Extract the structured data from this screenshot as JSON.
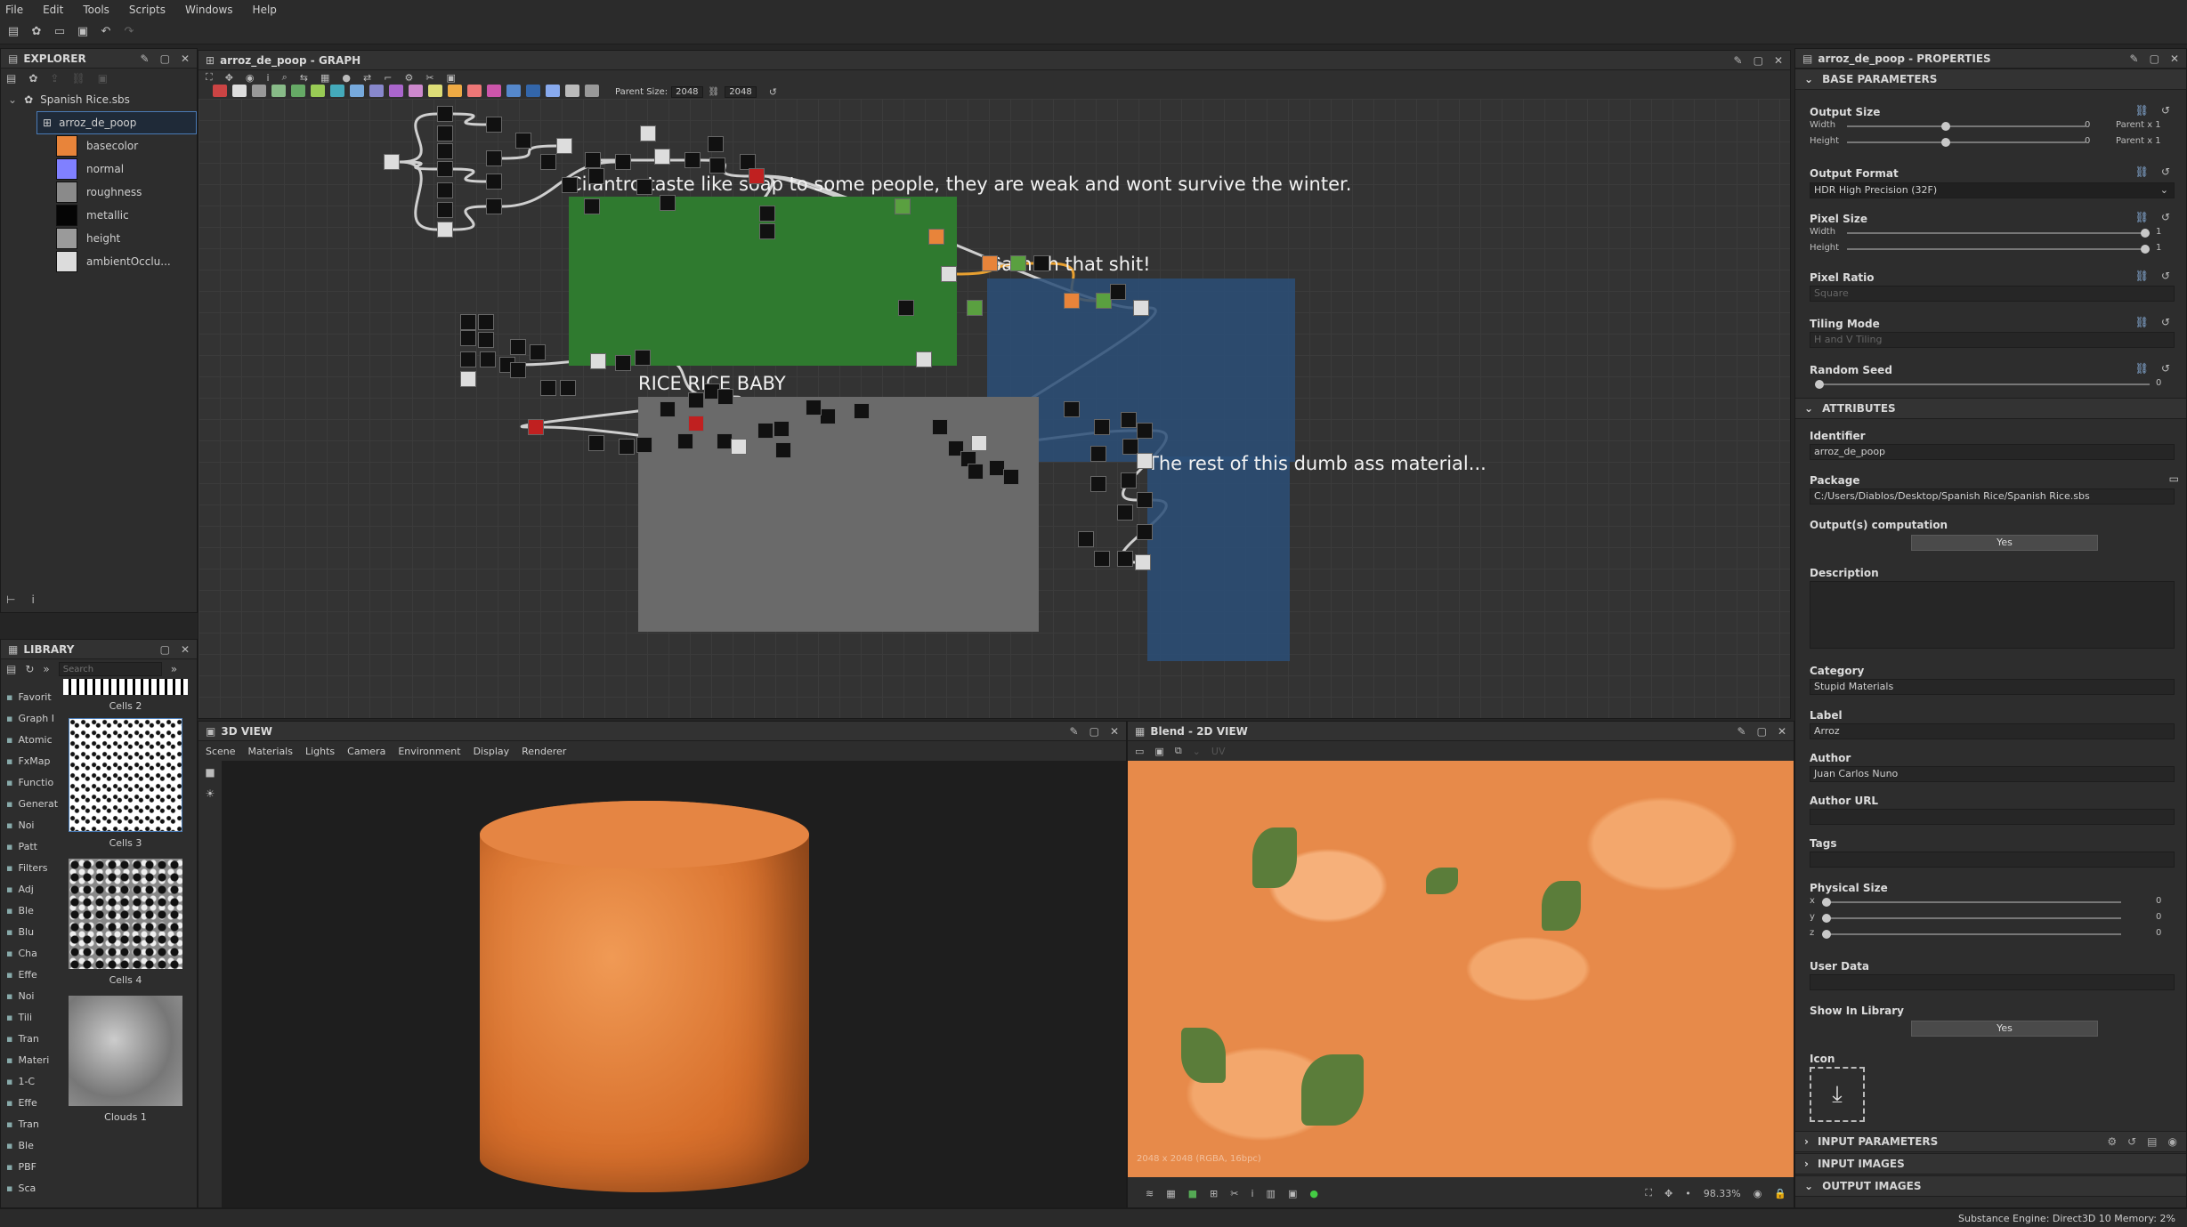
{
  "menu": [
    "File",
    "Edit",
    "Tools",
    "Scripts",
    "Windows",
    "Help"
  ],
  "explorer": {
    "title": "EXPLORER",
    "package": "Spanish Rice.sbs",
    "graph": "arroz_de_poop",
    "outputs": [
      {
        "label": "basecolor",
        "color": "#e8843a"
      },
      {
        "label": "normal",
        "color": "#8080ff"
      },
      {
        "label": "roughness",
        "color": "#8a8a8a"
      },
      {
        "label": "metallic",
        "color": "#050505"
      },
      {
        "label": "height",
        "color": "#9a9a9a"
      },
      {
        "label": "ambientOcclu...",
        "color": "#dcdcdc"
      }
    ]
  },
  "library": {
    "title": "LIBRARY",
    "search_placeholder": "Search",
    "categories": [
      "Favorit",
      "Graph I",
      "Atomic",
      "FxMap",
      "Functio",
      "Generat",
      "Noi",
      "Patt",
      "Filters",
      "Adj",
      "Ble",
      "Blu",
      "Cha",
      "Effe",
      "Noi",
      "Tili",
      "Tran",
      "Materi",
      "1-C",
      "Effe",
      "Tran",
      "Ble",
      "PBF",
      "Sca"
    ],
    "thumbs": [
      "Cells 2",
      "Cells 3",
      "Cells 4",
      "Clouds 1"
    ]
  },
  "graph": {
    "title": "arroz_de_poop - GRAPH",
    "parent_size_label": "Parent Size:",
    "parent_size": "2048",
    "size": "2048",
    "frames": [
      {
        "title": "Cilantro taste like soap to some people, they are weak and wont survive the winter.",
        "color": "#2f7a2f"
      },
      {
        "title": "Garnish that shit!",
        "color": "#2c4f78"
      },
      {
        "title": "RICE RICE BABY",
        "color": "#6a6a6a"
      },
      {
        "title": "The rest of this dumb ass material...",
        "color": "#2c4f78"
      }
    ]
  },
  "view3d": {
    "title": "3D VIEW",
    "menu": [
      "Scene",
      "Materials",
      "Lights",
      "Camera",
      "Environment",
      "Display",
      "Renderer"
    ]
  },
  "view2d": {
    "title": "Blend - 2D VIEW",
    "uv": "UV",
    "info": "2048 x 2048 (RGBA, 16bpc)",
    "zoom": "98.33%"
  },
  "props": {
    "title": "arroz_de_poop - PROPERTIES",
    "base": "BASE PARAMETERS",
    "attributes": "ATTRIBUTES",
    "output_size": "Output Size",
    "width": "Width",
    "height": "Height",
    "zero": "0",
    "parent_x1": "Parent x 1",
    "one": "1",
    "output_format": "Output Format",
    "format_value": "HDR High Precision (32F)",
    "pixel_size": "Pixel Size",
    "pixel_ratio": "Pixel Ratio",
    "pixel_ratio_value": "Square",
    "tiling_mode": "Tiling Mode",
    "tiling_value": "H and V Tiling",
    "random_seed": "Random Seed",
    "identifier": "Identifier",
    "identifier_value": "arroz_de_poop",
    "package": "Package",
    "package_value": "C:/Users/Diablos/Desktop/Spanish Rice/Spanish Rice.sbs",
    "outputs_comp": "Output(s) computation",
    "yes": "Yes",
    "description": "Description",
    "category": "Category",
    "category_value": "Stupid Materials",
    "label": "Label",
    "label_value": "Arroz",
    "author": "Author",
    "author_value": "Juan Carlos Nuno",
    "author_url": "Author URL",
    "tags": "Tags",
    "physical_size": "Physical Size",
    "x": "x",
    "y": "y",
    "z": "z",
    "user_data": "User Data",
    "show_in_library": "Show In Library",
    "icon": "Icon",
    "input_params": "INPUT PARAMETERS",
    "input_images": "INPUT IMAGES",
    "output_images": "OUTPUT IMAGES"
  },
  "status": "Substance Engine: Direct3D 10  Memory: 2%"
}
